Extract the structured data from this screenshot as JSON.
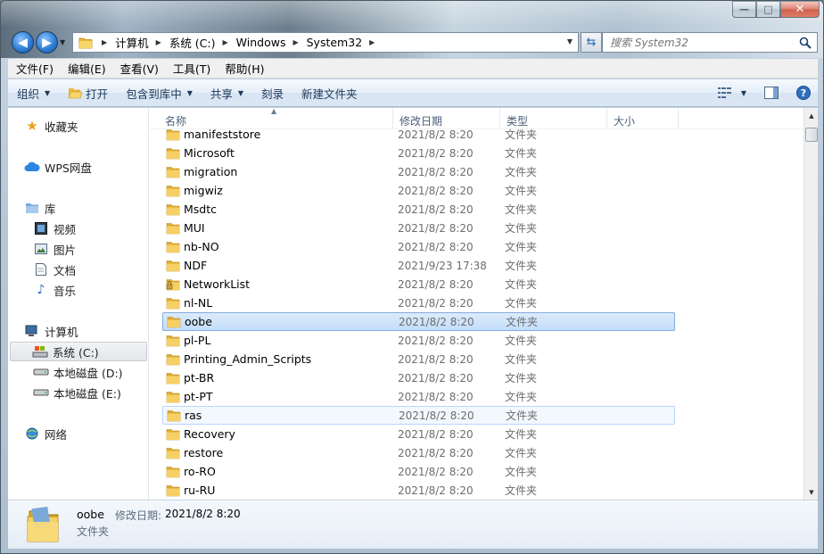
{
  "window": {
    "controls": {
      "minimize": "—",
      "maximize": "□",
      "close": "✕"
    }
  },
  "nav": {
    "address_crumbs": [
      "计算机",
      "系统 (C:)",
      "Windows",
      "System32"
    ],
    "search_placeholder": "搜索 System32"
  },
  "menubar": {
    "items": [
      "文件(F)",
      "编辑(E)",
      "查看(V)",
      "工具(T)",
      "帮助(H)"
    ]
  },
  "commandbar": {
    "organize": "组织",
    "open": "打开",
    "include_library": "包含到库中",
    "share": "共享",
    "burn": "刻录",
    "new_folder": "新建文件夹"
  },
  "sidebar": {
    "favorites": "收藏夹",
    "wps": "WPS网盘",
    "libraries": "库",
    "videos": "视频",
    "pictures": "图片",
    "documents": "文档",
    "music": "音乐",
    "computer": "计算机",
    "drive_c": "系统 (C:)",
    "drive_d": "本地磁盘 (D:)",
    "drive_e": "本地磁盘 (E:)",
    "network": "网络"
  },
  "columns": {
    "name": "名称",
    "date": "修改日期",
    "type": "类型",
    "size": "大小"
  },
  "files": [
    {
      "name": "manifeststore",
      "date": "2021/8/2 8:20",
      "type": "文件夹"
    },
    {
      "name": "Microsoft",
      "date": "2021/8/2 8:20",
      "type": "文件夹"
    },
    {
      "name": "migration",
      "date": "2021/8/2 8:20",
      "type": "文件夹"
    },
    {
      "name": "migwiz",
      "date": "2021/8/2 8:20",
      "type": "文件夹"
    },
    {
      "name": "Msdtc",
      "date": "2021/8/2 8:20",
      "type": "文件夹"
    },
    {
      "name": "MUI",
      "date": "2021/8/2 8:20",
      "type": "文件夹"
    },
    {
      "name": "nb-NO",
      "date": "2021/8/2 8:20",
      "type": "文件夹"
    },
    {
      "name": "NDF",
      "date": "2021/9/23 17:38",
      "type": "文件夹"
    },
    {
      "name": "NetworkList",
      "date": "2021/8/2 8:20",
      "type": "文件夹",
      "locked": true
    },
    {
      "name": "nl-NL",
      "date": "2021/8/2 8:20",
      "type": "文件夹"
    },
    {
      "name": "oobe",
      "date": "2021/8/2 8:20",
      "type": "文件夹",
      "state": "selected"
    },
    {
      "name": "pl-PL",
      "date": "2021/8/2 8:20",
      "type": "文件夹"
    },
    {
      "name": "Printing_Admin_Scripts",
      "date": "2021/8/2 8:20",
      "type": "文件夹"
    },
    {
      "name": "pt-BR",
      "date": "2021/8/2 8:20",
      "type": "文件夹"
    },
    {
      "name": "pt-PT",
      "date": "2021/8/2 8:20",
      "type": "文件夹"
    },
    {
      "name": "ras",
      "date": "2021/8/2 8:20",
      "type": "文件夹",
      "state": "hover"
    },
    {
      "name": "Recovery",
      "date": "2021/8/2 8:20",
      "type": "文件夹"
    },
    {
      "name": "restore",
      "date": "2021/8/2 8:20",
      "type": "文件夹"
    },
    {
      "name": "ro-RO",
      "date": "2021/8/2 8:20",
      "type": "文件夹"
    },
    {
      "name": "ru-RU",
      "date": "2021/8/2 8:20",
      "type": "文件夹"
    }
  ],
  "details": {
    "name": "oobe",
    "date_label": "修改日期:",
    "date": "2021/8/2 8:20",
    "type": "文件夹"
  },
  "colors": {
    "folder_yellow": "#f2c94c",
    "selection_blue": "#c4ddfa",
    "command_text": "#1e395b"
  }
}
